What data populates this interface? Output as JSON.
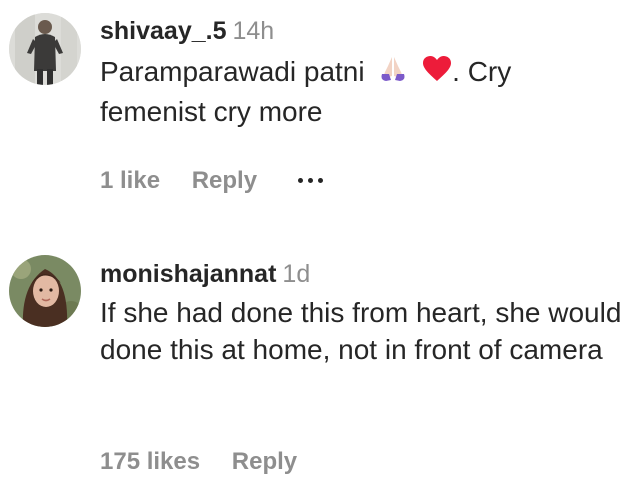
{
  "comments": [
    {
      "username": "shivaay_.5",
      "time": "14h",
      "text_before_emoji": "Paramparawadi patni",
      "emoji_names": [
        "folded-hands-icon",
        "red-heart-icon"
      ],
      "text_after_emoji": ". Cry",
      "text_line2": "femenist cry more",
      "likes": "1 like",
      "reply_label": "Reply",
      "avatar": "user-avatar-man"
    },
    {
      "username": "monishajannat",
      "time": "1d",
      "text": "If she had done this from heart, she would done this at home, not in front of camera",
      "likes": "175 likes",
      "reply_label": "Reply",
      "avatar": "user-avatar-woman"
    }
  ],
  "colors": {
    "text": "#262626",
    "muted": "#8e8e8e",
    "heart": "#ED1C3A"
  }
}
